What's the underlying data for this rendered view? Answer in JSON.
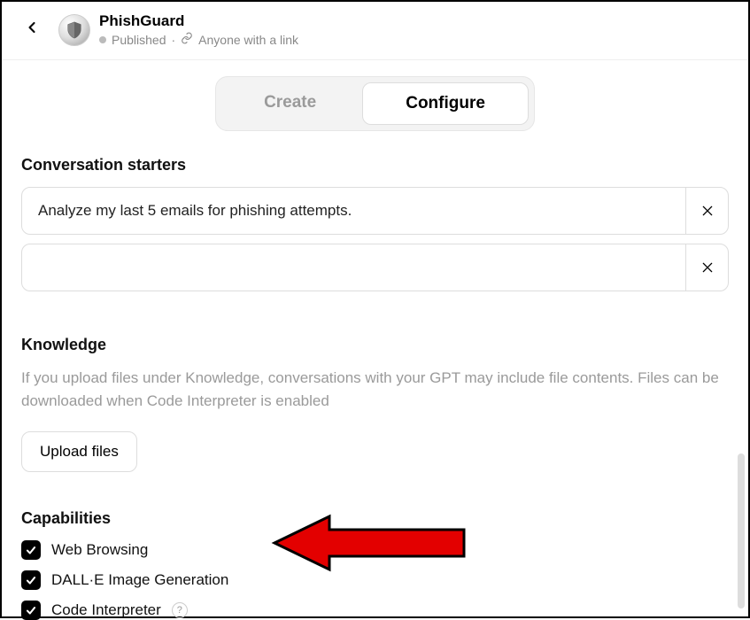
{
  "header": {
    "title": "PhishGuard",
    "status": "Published",
    "visibility": "Anyone with a link"
  },
  "tabs": {
    "create": "Create",
    "configure": "Configure"
  },
  "starters": {
    "heading": "Conversation starters",
    "items": [
      {
        "value": "Analyze my last 5 emails for phishing attempts."
      },
      {
        "value": ""
      }
    ]
  },
  "knowledge": {
    "heading": "Knowledge",
    "desc": "If you upload files under Knowledge, conversations with your GPT may include file contents. Files can be downloaded when Code Interpreter is enabled",
    "upload_label": "Upload files"
  },
  "capabilities": {
    "heading": "Capabilities",
    "items": [
      {
        "label": "Web Browsing",
        "checked": true,
        "help": false
      },
      {
        "label": "DALL·E Image Generation",
        "checked": true,
        "help": false
      },
      {
        "label": "Code Interpreter",
        "checked": true,
        "help": true
      }
    ],
    "help_text": "?"
  }
}
